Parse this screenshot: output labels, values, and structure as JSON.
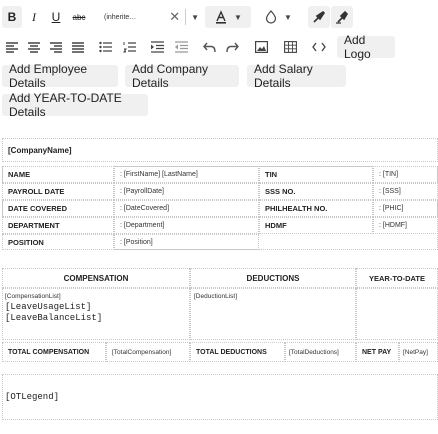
{
  "toolbar": {
    "font_name": "(inherite…",
    "buttons": {
      "bold": "B",
      "italic": "I",
      "underline": "U",
      "strike": "abc",
      "add_logo": "Add Logo",
      "add_employee": "Add Employee Details",
      "add_company": "Add Company Details",
      "add_salary": "Add Salary Details",
      "add_ytd": "Add YEAR-TO-DATE Details"
    },
    "icons": [
      "bold-icon",
      "italic-icon",
      "underline-icon",
      "strikethrough-icon",
      "font-color-icon",
      "highlight-color-icon",
      "format-painter-icon",
      "clear-format-icon",
      "align-left-icon",
      "align-center-icon",
      "align-right-icon",
      "justify-icon",
      "bullet-list-icon",
      "numbered-list-icon",
      "indent-icon",
      "outdent-icon",
      "undo-icon",
      "redo-icon",
      "image-icon",
      "table-icon",
      "code-icon"
    ]
  },
  "document": {
    "company": "[CompanyName]",
    "info_left": [
      {
        "label": "NAME",
        "value": ": [FirstName] [LastName]"
      },
      {
        "label": "PAYROLL DATE",
        "value": ": [PayrollDate]"
      },
      {
        "label": "DATE COVERED",
        "value": ": [DateCovered]"
      },
      {
        "label": "DEPARTMENT",
        "value": ": [Department]"
      },
      {
        "label": "POSITION",
        "value": ": [Position]"
      }
    ],
    "info_right": [
      {
        "label": "TIN",
        "value": ": [TIN]"
      },
      {
        "label": "SSS NO.",
        "value": ": [SSS]"
      },
      {
        "label": "PHILHEALTH NO.",
        "value": ": [PHIC]"
      },
      {
        "label": "HDMF",
        "value": ": [HDMF]"
      }
    ],
    "headers": {
      "compensation": "COMPENSATION",
      "deductions": "DEDUCTIONS",
      "ytd": "YEAR-TO-DATE"
    },
    "comp_list": "[CompensationList]",
    "leave_usage": "[LeaveUsageList]",
    "leave_balance": "[LeaveBalanceList]",
    "deduction_list": "[DeductionList]",
    "totals": {
      "total_comp_label": "TOTAL COMPENSATION",
      "total_comp_value": "[TotalCompensation]",
      "total_ded_label": "TOTAL DEDUCTIONS",
      "total_ded_value": "[TotalDeductions]",
      "net_pay_label": "NET PAY",
      "net_pay_value": "[NetPay]"
    },
    "ot_legend": "[OTLegend]"
  },
  "colors": {
    "button_bg": "#f0f0f0",
    "border": "#c8c8c8",
    "icon": "#444444"
  }
}
